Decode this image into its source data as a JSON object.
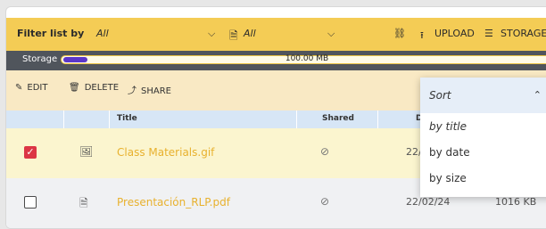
{
  "toolbar": {
    "filter_label": "Filter list by",
    "filter_value": "All",
    "type_value": "All",
    "link_icon": "link-icon",
    "upload_label": "UPLOAD",
    "storage_label": "STORAGE",
    "chevron": "⌄"
  },
  "storage": {
    "label": "Storage",
    "used": "100.00 MB",
    "used_fraction": 0.05
  },
  "actions": {
    "edit": "EDIT",
    "delete": "DELETE",
    "share": "SHARE"
  },
  "table": {
    "columns": [
      "Title",
      "Shared",
      "D"
    ],
    "rows": [
      {
        "checked": true,
        "name": "Class Materials.gif",
        "date": "22/0",
        "size": ""
      },
      {
        "checked": false,
        "name": "Presentación_RLP.pdf",
        "date": "22/02/24",
        "size": "1016 KB"
      }
    ]
  },
  "sort": {
    "title": "Sort",
    "options": [
      "by title",
      "by date",
      "by size"
    ],
    "selected": "by title"
  },
  "colors": {
    "accent_yellow": "#f4cc55",
    "storage_fill": "#5b37c9",
    "checkbox_checked": "#dc3545",
    "file_name": "#e8b12e"
  }
}
